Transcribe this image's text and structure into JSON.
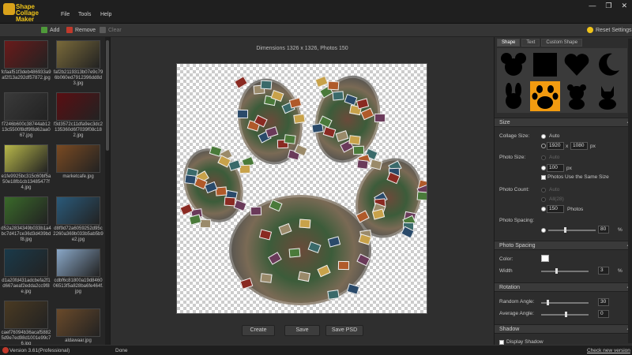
{
  "window": {
    "title": "Shape Collage Maker",
    "controls": [
      "—",
      "❐",
      "✕"
    ]
  },
  "menu": [
    "File",
    "Tools",
    "Help"
  ],
  "toolbar": {
    "add": "Add",
    "remove": "Remove",
    "clear": "Clear",
    "reset": "Reset Settings"
  },
  "thumbnails": [
    {
      "label": "fcfaaf51f3deb486933a9af2f13a292df57872.jpg",
      "color": "#6a1a1a"
    },
    {
      "label": "faf2b2119313b07e9c796b060ed7912396dd8d3.jpg",
      "color": "#7a6a3a"
    },
    {
      "label": "f7246b600c38744ab1213c5500f8df9f8d62aa067.jpg",
      "color": "#3a3a3a"
    },
    {
      "label": "f3d3572c11dfa9ec3dc2135360d6f7039f08c182.jpg",
      "color": "#5a0e12"
    },
    {
      "label": "e1fe9925bc315c60bf5a50e18fb1cb13485477f4.jpg",
      "color": "#b8b84a"
    },
    {
      "label": "marketcafe.jpg",
      "color": "#7a4a22"
    },
    {
      "label": "d52a2834349b033b1a4bc7d417ce36d3d439bdf8.jpg",
      "color": "#3a6a2a"
    },
    {
      "label": "d8f9d72a6059252d95c2260a369b033b5ab5b9e2.jpg",
      "color": "#2a5a7a"
    },
    {
      "label": "d1a20fd431adcbefa2f1d667aeaf2edda2cc9f8e.jpg",
      "color": "#1a3a4a"
    },
    {
      "label": "cdbf6c81800a19d846006513f5a828ba6fe464f.jpg",
      "color": "#8aa8c8"
    },
    {
      "label": "caef76094b36acaf58825d9e7ed98d1001e99c76.jpg",
      "color": "#4a3a22"
    },
    {
      "label": "aldawaar.jpg",
      "color": "#6a4a2a"
    }
  ],
  "canvas": {
    "dimensions": "Dimensions 1326 x 1326, Photos 150"
  },
  "actions": {
    "create": "Create",
    "save": "Save",
    "save_psd": "Save PSD"
  },
  "right_panel": {
    "tabs": [
      "Shape",
      "Text",
      "Custom Shape"
    ],
    "shapes": [
      "mouse-icon",
      "square-icon",
      "heart-icon",
      "moon-icon",
      "bunny-icon",
      "paw-icon",
      "bear-icon",
      "cat-icon"
    ],
    "size_section": {
      "title": "Size",
      "collage_size_label": "Collage Size:",
      "auto_label": "Auto",
      "width": "1920",
      "x_label": "x",
      "height": "1080",
      "px_label": "px",
      "photo_size_label": "Photo Size:",
      "photo_size_auto": "Auto",
      "photo_size_value": "100",
      "photo_size_px": "px",
      "same_size_label": "Photos Use the Same Size",
      "photo_count_label": "Photo Count:",
      "count_auto": "Auto",
      "count_all": "All(28)",
      "count_value": "150",
      "photos_label": "Photos",
      "spacing_label": "Photo Spacing:",
      "spacing_value": "80",
      "spacing_unit": "%"
    },
    "photo_spacing_section": {
      "title": "Photo Spacing",
      "color_label": "Color:",
      "width_label": "Width",
      "width_value": "3",
      "width_unit": "%"
    },
    "rotation_section": {
      "title": "Rotation",
      "random_label": "Random Angle:",
      "random_value": "30",
      "average_label": "Average Angle:",
      "average_value": "0"
    },
    "shadow_section": {
      "title": "Shadow",
      "display_label": "Display Shadow"
    }
  },
  "status": {
    "version": "Version 3.61(Professional)",
    "state": "Done",
    "check": "Check new version"
  }
}
